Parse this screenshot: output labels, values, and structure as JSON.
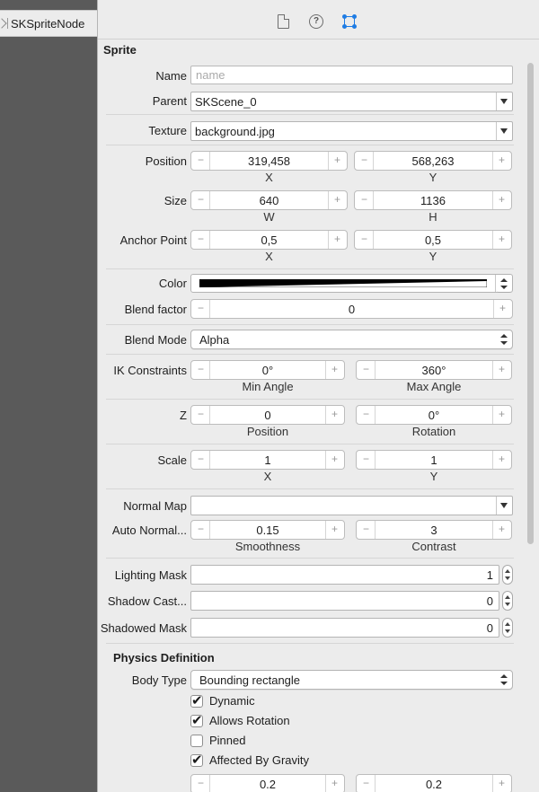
{
  "left": {
    "node_label": "SKSpriteNode"
  },
  "topbar": {
    "help_glyph": "?"
  },
  "sprite": {
    "title": "Sprite",
    "name_label": "Name",
    "name_placeholder": "name",
    "parent_label": "Parent",
    "parent_value": "SKScene_0",
    "texture_label": "Texture",
    "texture_value": "background.jpg",
    "position_label": "Position",
    "position_x": "319,458",
    "position_y": "568,263",
    "size_label": "Size",
    "size_w": "640",
    "size_h": "1136",
    "anchor_label": "Anchor Point",
    "anchor_x": "0,5",
    "anchor_y": "0,5",
    "sub_x": "X",
    "sub_y": "Y",
    "sub_w": "W",
    "sub_h": "H",
    "color_label": "Color",
    "blend_factor_label": "Blend factor",
    "blend_factor_value": "0",
    "blend_mode_label": "Blend Mode",
    "blend_mode_value": "Alpha",
    "ik_label": "IK Constraints",
    "ik_min": "0°",
    "ik_max": "360°",
    "ik_min_sub": "Min Angle",
    "ik_max_sub": "Max Angle",
    "z_label": "Z",
    "z_position": "0",
    "z_rotation": "0°",
    "z_position_sub": "Position",
    "z_rotation_sub": "Rotation",
    "scale_label": "Scale",
    "scale_x": "1",
    "scale_y": "1",
    "normal_map_label": "Normal Map",
    "auto_normal_label": "Auto Normal...",
    "smoothness": "0.15",
    "contrast": "3",
    "smoothness_sub": "Smoothness",
    "contrast_sub": "Contrast",
    "lighting_label": "Lighting Mask",
    "lighting_value": "1",
    "shadow_cast_label": "Shadow Cast...",
    "shadow_cast_value": "0",
    "shadowed_label": "Shadowed Mask",
    "shadowed_value": "0"
  },
  "physics": {
    "title": "Physics Definition",
    "body_type_label": "Body Type",
    "body_type_value": "Bounding rectangle",
    "dynamic_label": "Dynamic",
    "rotation_label": "Allows Rotation",
    "pinned_label": "Pinned",
    "gravity_label": "Affected By Gravity",
    "partial_left": "0.2",
    "partial_right": "0.2"
  },
  "glyphs": {
    "minus": "−",
    "plus": "+"
  }
}
